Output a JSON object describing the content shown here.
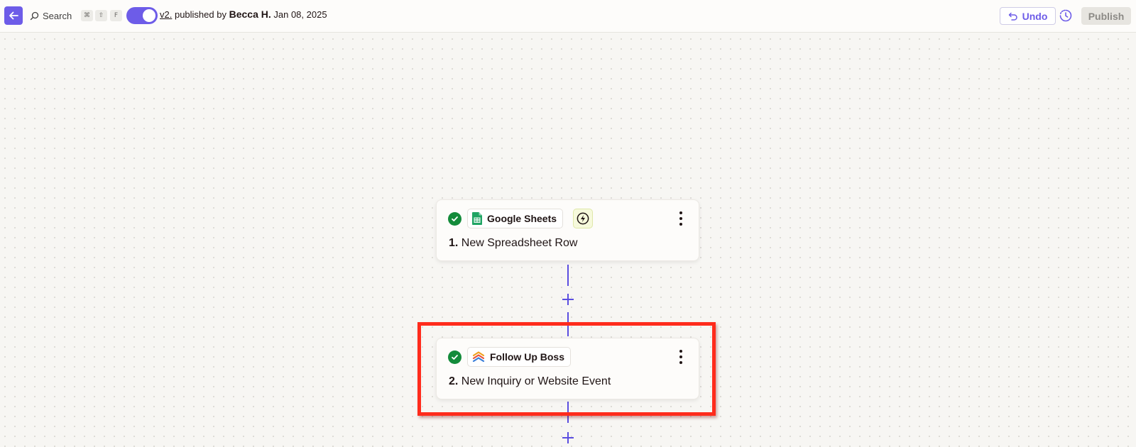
{
  "topbar": {
    "search_label": "Search",
    "shortcut_keys": [
      "⌘",
      "⇧",
      "F"
    ],
    "version": "v2.",
    "published_by": "published by",
    "author": "Becca H.",
    "date": "Jan 08, 2025",
    "undo_label": "Undo",
    "publish_label": "Publish"
  },
  "steps": [
    {
      "app": "Google Sheets",
      "number": "1.",
      "title": "New Spreadsheet Row",
      "status": "complete"
    },
    {
      "app": "Follow Up Boss",
      "number": "2.",
      "title": "New Inquiry or Website Event",
      "status": "complete"
    }
  ],
  "colors": {
    "accent": "#6d5ce8",
    "connector": "#5b4ee0",
    "success": "#138b3a",
    "highlight": "#ff2b1c"
  },
  "icons": {
    "back": "arrow-left-icon",
    "search": "search-icon",
    "undo": "undo-icon",
    "history": "history-icon",
    "check": "check-circle-icon",
    "trigger": "lightning-icon",
    "menu": "more-vertical-icon"
  }
}
